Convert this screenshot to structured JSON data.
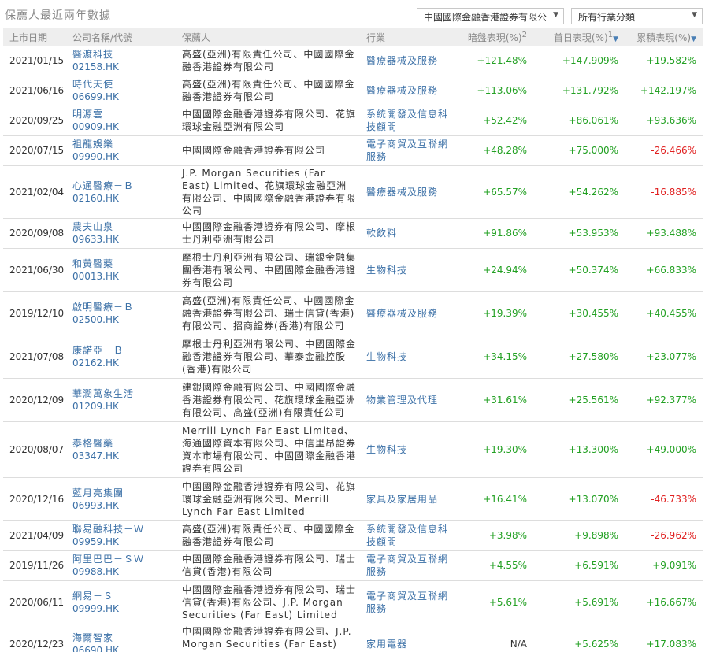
{
  "header": {
    "title": "保薦人最近兩年數據",
    "broker_select": "中國國際金融香港證券有限公",
    "industry_select": "所有行業分類"
  },
  "columns": {
    "date": "上市日期",
    "company": "公司名稱/代號",
    "sponsor": "保薦人",
    "industry": "行業",
    "grey": "暗盤表現(%)",
    "grey_note": "2",
    "first_day": "首日表現(%)",
    "first_day_note": "1",
    "cumulative": "累積表現(%)"
  },
  "rows": [
    {
      "date": "2021/01/15",
      "name": "醫渡科技",
      "code": "02158.HK",
      "sponsor": "高盛(亞洲)有限責任公司、中國國際金融香港證券有限公司",
      "industry": "醫療器械及服務",
      "grey": "+121.48%",
      "first": "+147.909%",
      "cum": "+19.582%"
    },
    {
      "date": "2021/06/16",
      "name": "時代天使",
      "code": "06699.HK",
      "sponsor": "高盛(亞洲)有限責任公司、中國國際金融香港證券有限公司",
      "industry": "醫療器械及服務",
      "grey": "+113.06%",
      "first": "+131.792%",
      "cum": "+142.197%"
    },
    {
      "date": "2020/09/25",
      "name": "明源雲",
      "code": "00909.HK",
      "sponsor": "中國國際金融香港證券有限公司、花旗環球金融亞洲有限公司",
      "industry": "系統開發及信息科技顧問",
      "grey": "+52.42%",
      "first": "+86.061%",
      "cum": "+93.636%"
    },
    {
      "date": "2020/07/15",
      "name": "祖龍娛樂",
      "code": "09990.HK",
      "sponsor": "中國國際金融香港證券有限公司",
      "industry": "電子商貿及互聯網服務",
      "grey": "+48.28%",
      "first": "+75.000%",
      "cum": "-26.466%"
    },
    {
      "date": "2021/02/04",
      "name": "心通醫療－Ｂ",
      "code": "02160.HK",
      "sponsor": "J.P. Morgan Securities (Far East) Limited、花旗環球金融亞洲有限公司、中國國際金融香港證券有限公司",
      "industry": "醫療器械及服務",
      "grey": "+65.57%",
      "first": "+54.262%",
      "cum": "-16.885%"
    },
    {
      "date": "2020/09/08",
      "name": "農夫山泉",
      "code": "09633.HK",
      "sponsor": "中國國際金融香港證券有限公司、摩根士丹利亞洲有限公司",
      "industry": "軟飲料",
      "grey": "+91.86%",
      "first": "+53.953%",
      "cum": "+93.488%"
    },
    {
      "date": "2021/06/30",
      "name": "和黃醫藥",
      "code": "00013.HK",
      "sponsor": "摩根士丹利亞洲有限公司、瑞銀金融集團香港有限公司、中國國際金融香港證券有限公司",
      "industry": "生物科技",
      "grey": "+24.94%",
      "first": "+50.374%",
      "cum": "+66.833%"
    },
    {
      "date": "2019/12/10",
      "name": "啟明醫療－Ｂ",
      "code": "02500.HK",
      "sponsor": "高盛(亞洲)有限責任公司、中國國際金融香港證券有限公司、瑞士信貸(香港)有限公司、招商證券(香港)有限公司",
      "industry": "醫療器械及服務",
      "grey": "+19.39%",
      "first": "+30.455%",
      "cum": "+40.455%"
    },
    {
      "date": "2021/07/08",
      "name": "康諾亞－Ｂ",
      "code": "02162.HK",
      "sponsor": "摩根士丹利亞洲有限公司、中國國際金融香港證券有限公司、華泰金融控股(香港)有限公司",
      "industry": "生物科技",
      "grey": "+34.15%",
      "first": "+27.580%",
      "cum": "+23.077%"
    },
    {
      "date": "2020/12/09",
      "name": "華潤萬象生活",
      "code": "01209.HK",
      "sponsor": "建銀國際金融有限公司、中國國際金融香港證券有限公司、花旗環球金融亞洲有限公司、高盛(亞洲)有限責任公司",
      "industry": "物業管理及代理",
      "grey": "+31.61%",
      "first": "+25.561%",
      "cum": "+92.377%"
    },
    {
      "date": "2020/08/07",
      "name": "泰格醫藥",
      "code": "03347.HK",
      "sponsor": "Merrill Lynch Far East Limited、海通國際資本有限公司、中信里昂證券資本市場有限公司、中國國際金融香港證券有限公司",
      "industry": "生物科技",
      "grey": "+19.30%",
      "first": "+13.300%",
      "cum": "+49.000%"
    },
    {
      "date": "2020/12/16",
      "name": "藍月亮集團",
      "code": "06993.HK",
      "sponsor": "中國國際金融香港證券有限公司、花旗環球金融亞洲有限公司、Merrill Lynch Far East Limited",
      "industry": "家具及家居用品",
      "grey": "+16.41%",
      "first": "+13.070%",
      "cum": "-46.733%"
    },
    {
      "date": "2021/04/09",
      "name": "聯易融科技－Ｗ",
      "code": "09959.HK",
      "sponsor": "高盛(亞洲)有限責任公司、中國國際金融香港證券有限公司",
      "industry": "系統開發及信息科技顧問",
      "grey": "+3.98%",
      "first": "+9.898%",
      "cum": "-26.962%"
    },
    {
      "date": "2019/11/26",
      "name": "阿里巴巴－ＳＷ",
      "code": "09988.HK",
      "sponsor": "中國國際金融香港證券有限公司、瑞士信貸(香港)有限公司",
      "industry": "電子商貿及互聯網服務",
      "grey": "+4.55%",
      "first": "+6.591%",
      "cum": "+9.091%"
    },
    {
      "date": "2020/06/11",
      "name": "網易－Ｓ",
      "code": "09999.HK",
      "sponsor": "中國國際金融香港證券有限公司、瑞士信貸(香港)有限公司、J.P. Morgan Securities (Far East) Limited",
      "industry": "電子商貿及互聯網服務",
      "grey": "+5.61%",
      "first": "+5.691%",
      "cum": "+16.667%"
    },
    {
      "date": "2020/12/23",
      "name": "海爾智家",
      "code": "06690.HK",
      "sponsor": "中國國際金融香港證券有限公司、J.P. Morgan Securities (Far East) Limited",
      "industry": "家用電器",
      "grey": "N/A",
      "first": "+5.625%",
      "cum": "+17.083%"
    }
  ]
}
